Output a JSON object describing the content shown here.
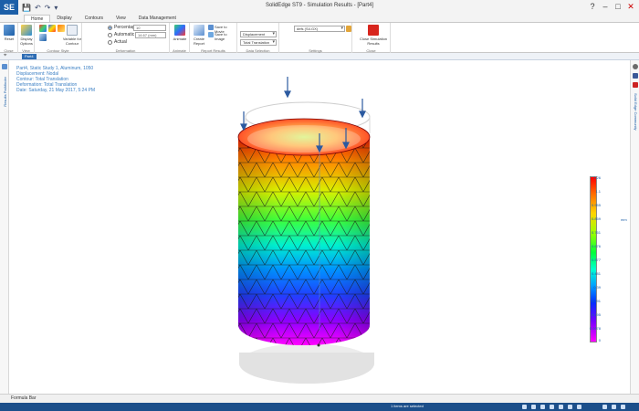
{
  "window": {
    "title": "SolidEdge ST9 - Simulation Results - [Part4]",
    "app_logo": "SE"
  },
  "quick_access": [
    "💾",
    "↶",
    "↷",
    "▾"
  ],
  "ribbon_tabs": [
    "Home",
    "Display",
    "Contours",
    "View",
    "Data Management"
  ],
  "ribbon": {
    "groups": {
      "close": "Close",
      "view": "View",
      "contour_style": "Contour Style",
      "deformation": "Deformation",
      "animate": "Animate",
      "report_results": "Report Results",
      "data_selection": "Data Selection",
      "settings": "Settings",
      "close_sim": "Close"
    },
    "buttons": {
      "reset": "Reset",
      "display_options": "Display Options",
      "variable_for_contour": "Variable for Contour",
      "animate": "Animate",
      "create_report": "Create Report",
      "save_to_movie": "Save to Movie",
      "save_to_image": "Save to Image",
      "close_simulation": "Close Simulation Results"
    },
    "deformation_options": [
      "Percentage",
      "Automatic",
      "Actual"
    ],
    "percentage_value": "10",
    "automatic_value": "14.67 (mm)",
    "result_type": "Displacement",
    "result_component": "Total Translation",
    "settings_value": "defs (S4.GX)"
  },
  "doc_tab": "Part4",
  "left_vtab": "Results Pathfinder",
  "right_vtab": "Solid Edge Community",
  "info_lines": [
    "Part4, Static Study 1, Aluminum, 1050",
    "Displacement: Nodal",
    "Contour: Total Translation",
    "Deformation: Total Translation",
    "Date: Saturday, 21 May 2017, 5:24 PM"
  ],
  "units": "mm",
  "colorbar_labels": [
    "1.26",
    "1.1",
    "0.955",
    "0.859",
    "0.761",
    "0.676",
    "0.577",
    "0.481",
    "0.39",
    "0.291",
    "0.195",
    "0.0978",
    "0"
  ],
  "status": {
    "formula_tab": "Formula Bar",
    "message": "1 items are selected"
  },
  "colors": {
    "accent": "#1c5fa8",
    "info_text": "#3a7fc4",
    "statusbar": "#1c4f8a"
  }
}
